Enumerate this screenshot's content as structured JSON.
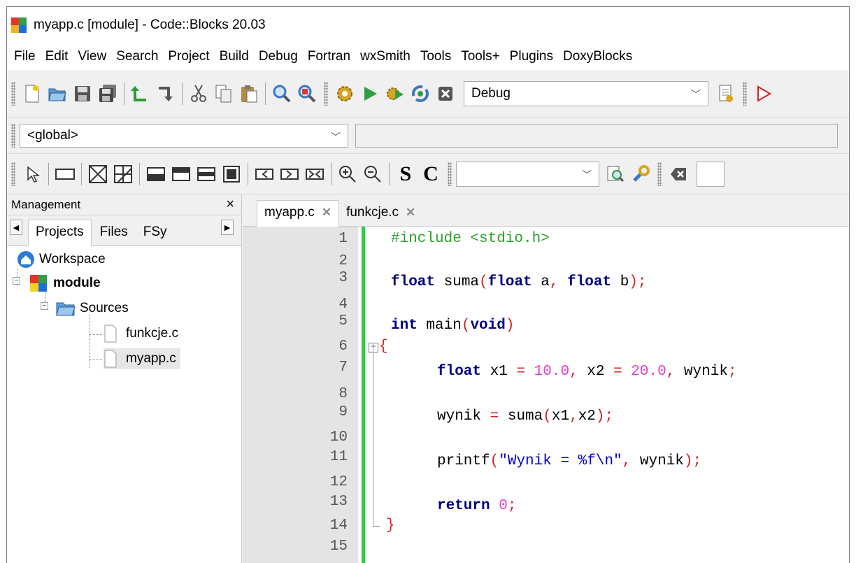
{
  "window": {
    "title": "myapp.c [module] - Code::Blocks 20.03"
  },
  "menu": [
    "File",
    "Edit",
    "View",
    "Search",
    "Project",
    "Build",
    "Debug",
    "Fortran",
    "wxSmith",
    "Tools",
    "Tools+",
    "Plugins",
    "DoxyBlocks"
  ],
  "toolbar": {
    "build_target": "Debug"
  },
  "code_completion": {
    "scope": "<global>"
  },
  "wxsmith_toolbar": {
    "s_label": "S",
    "c_label": "C",
    "combo_value": ""
  },
  "management": {
    "title": "Management",
    "close": "×",
    "tabs": [
      "Projects",
      "Files",
      "FSy"
    ],
    "tree": {
      "workspace": "Workspace",
      "project": "module",
      "folder": "Sources",
      "files": [
        "funkcje.c",
        "myapp.c"
      ]
    }
  },
  "editor": {
    "tabs": [
      {
        "label": "myapp.c",
        "close": "✕"
      },
      {
        "label": "funkcje.c",
        "close": "✕"
      }
    ],
    "line_numbers": [
      "1",
      "2",
      "3",
      "4",
      "5",
      "6",
      "7",
      "8",
      "9",
      "10",
      "11",
      "12",
      "13",
      "14",
      "15"
    ],
    "code": {
      "l1_directive": "#include <stdio.h>",
      "l3_kw1": "float",
      "l3_name": " suma",
      "l3_p1": "(",
      "l3_kw2": "float",
      "l3_a": " a",
      "l3_comma": ",",
      "l3_kw3": " float",
      "l3_b": " b",
      "l3_end": ");",
      "l5_kw1": "int",
      "l5_name": " main",
      "l5_p1": "(",
      "l5_kw2": "void",
      "l5_p2": ")",
      "l6_brace": "{",
      "l7_kw": "float",
      "l7_x1": " x1 ",
      "l7_eq1": "=",
      "l7_n1": " 10.0",
      "l7_c1": ",",
      "l7_x2": " x2 ",
      "l7_eq2": "=",
      "l7_n2": " 20.0",
      "l7_c2": ",",
      "l7_rest": " wynik",
      "l7_semi": ";",
      "l9_a": "wynik ",
      "l9_eq": "=",
      "l9_b": " suma",
      "l9_p1": "(",
      "l9_args": "x1",
      "l9_c": ",",
      "l9_args2": "x2",
      "l9_end": ");",
      "l11_fn": "printf",
      "l11_p1": "(",
      "l11_str": "\"Wynik = %f\\n\"",
      "l11_c": ",",
      "l11_arg": " wynik",
      "l11_end": ");",
      "l13_kw": "return",
      "l13_num": " 0",
      "l13_semi": ";",
      "l14_brace": "}"
    }
  }
}
